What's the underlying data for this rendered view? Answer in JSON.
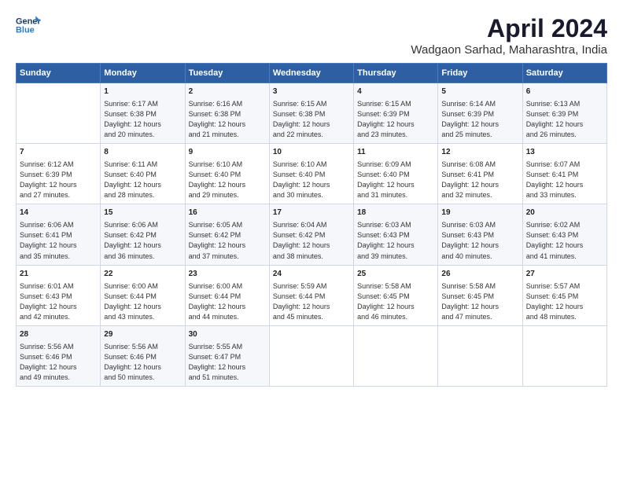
{
  "logo": {
    "line1": "General",
    "line2": "Blue"
  },
  "title": "April 2024",
  "subtitle": "Wadgaon Sarhad, Maharashtra, India",
  "weekdays": [
    "Sunday",
    "Monday",
    "Tuesday",
    "Wednesday",
    "Thursday",
    "Friday",
    "Saturday"
  ],
  "weeks": [
    [
      {
        "day": "",
        "text": ""
      },
      {
        "day": "1",
        "text": "Sunrise: 6:17 AM\nSunset: 6:38 PM\nDaylight: 12 hours\nand 20 minutes."
      },
      {
        "day": "2",
        "text": "Sunrise: 6:16 AM\nSunset: 6:38 PM\nDaylight: 12 hours\nand 21 minutes."
      },
      {
        "day": "3",
        "text": "Sunrise: 6:15 AM\nSunset: 6:38 PM\nDaylight: 12 hours\nand 22 minutes."
      },
      {
        "day": "4",
        "text": "Sunrise: 6:15 AM\nSunset: 6:39 PM\nDaylight: 12 hours\nand 23 minutes."
      },
      {
        "day": "5",
        "text": "Sunrise: 6:14 AM\nSunset: 6:39 PM\nDaylight: 12 hours\nand 25 minutes."
      },
      {
        "day": "6",
        "text": "Sunrise: 6:13 AM\nSunset: 6:39 PM\nDaylight: 12 hours\nand 26 minutes."
      }
    ],
    [
      {
        "day": "7",
        "text": "Sunrise: 6:12 AM\nSunset: 6:39 PM\nDaylight: 12 hours\nand 27 minutes."
      },
      {
        "day": "8",
        "text": "Sunrise: 6:11 AM\nSunset: 6:40 PM\nDaylight: 12 hours\nand 28 minutes."
      },
      {
        "day": "9",
        "text": "Sunrise: 6:10 AM\nSunset: 6:40 PM\nDaylight: 12 hours\nand 29 minutes."
      },
      {
        "day": "10",
        "text": "Sunrise: 6:10 AM\nSunset: 6:40 PM\nDaylight: 12 hours\nand 30 minutes."
      },
      {
        "day": "11",
        "text": "Sunrise: 6:09 AM\nSunset: 6:40 PM\nDaylight: 12 hours\nand 31 minutes."
      },
      {
        "day": "12",
        "text": "Sunrise: 6:08 AM\nSunset: 6:41 PM\nDaylight: 12 hours\nand 32 minutes."
      },
      {
        "day": "13",
        "text": "Sunrise: 6:07 AM\nSunset: 6:41 PM\nDaylight: 12 hours\nand 33 minutes."
      }
    ],
    [
      {
        "day": "14",
        "text": "Sunrise: 6:06 AM\nSunset: 6:41 PM\nDaylight: 12 hours\nand 35 minutes."
      },
      {
        "day": "15",
        "text": "Sunrise: 6:06 AM\nSunset: 6:42 PM\nDaylight: 12 hours\nand 36 minutes."
      },
      {
        "day": "16",
        "text": "Sunrise: 6:05 AM\nSunset: 6:42 PM\nDaylight: 12 hours\nand 37 minutes."
      },
      {
        "day": "17",
        "text": "Sunrise: 6:04 AM\nSunset: 6:42 PM\nDaylight: 12 hours\nand 38 minutes."
      },
      {
        "day": "18",
        "text": "Sunrise: 6:03 AM\nSunset: 6:43 PM\nDaylight: 12 hours\nand 39 minutes."
      },
      {
        "day": "19",
        "text": "Sunrise: 6:03 AM\nSunset: 6:43 PM\nDaylight: 12 hours\nand 40 minutes."
      },
      {
        "day": "20",
        "text": "Sunrise: 6:02 AM\nSunset: 6:43 PM\nDaylight: 12 hours\nand 41 minutes."
      }
    ],
    [
      {
        "day": "21",
        "text": "Sunrise: 6:01 AM\nSunset: 6:43 PM\nDaylight: 12 hours\nand 42 minutes."
      },
      {
        "day": "22",
        "text": "Sunrise: 6:00 AM\nSunset: 6:44 PM\nDaylight: 12 hours\nand 43 minutes."
      },
      {
        "day": "23",
        "text": "Sunrise: 6:00 AM\nSunset: 6:44 PM\nDaylight: 12 hours\nand 44 minutes."
      },
      {
        "day": "24",
        "text": "Sunrise: 5:59 AM\nSunset: 6:44 PM\nDaylight: 12 hours\nand 45 minutes."
      },
      {
        "day": "25",
        "text": "Sunrise: 5:58 AM\nSunset: 6:45 PM\nDaylight: 12 hours\nand 46 minutes."
      },
      {
        "day": "26",
        "text": "Sunrise: 5:58 AM\nSunset: 6:45 PM\nDaylight: 12 hours\nand 47 minutes."
      },
      {
        "day": "27",
        "text": "Sunrise: 5:57 AM\nSunset: 6:45 PM\nDaylight: 12 hours\nand 48 minutes."
      }
    ],
    [
      {
        "day": "28",
        "text": "Sunrise: 5:56 AM\nSunset: 6:46 PM\nDaylight: 12 hours\nand 49 minutes."
      },
      {
        "day": "29",
        "text": "Sunrise: 5:56 AM\nSunset: 6:46 PM\nDaylight: 12 hours\nand 50 minutes."
      },
      {
        "day": "30",
        "text": "Sunrise: 5:55 AM\nSunset: 6:47 PM\nDaylight: 12 hours\nand 51 minutes."
      },
      {
        "day": "",
        "text": ""
      },
      {
        "day": "",
        "text": ""
      },
      {
        "day": "",
        "text": ""
      },
      {
        "day": "",
        "text": ""
      }
    ]
  ]
}
